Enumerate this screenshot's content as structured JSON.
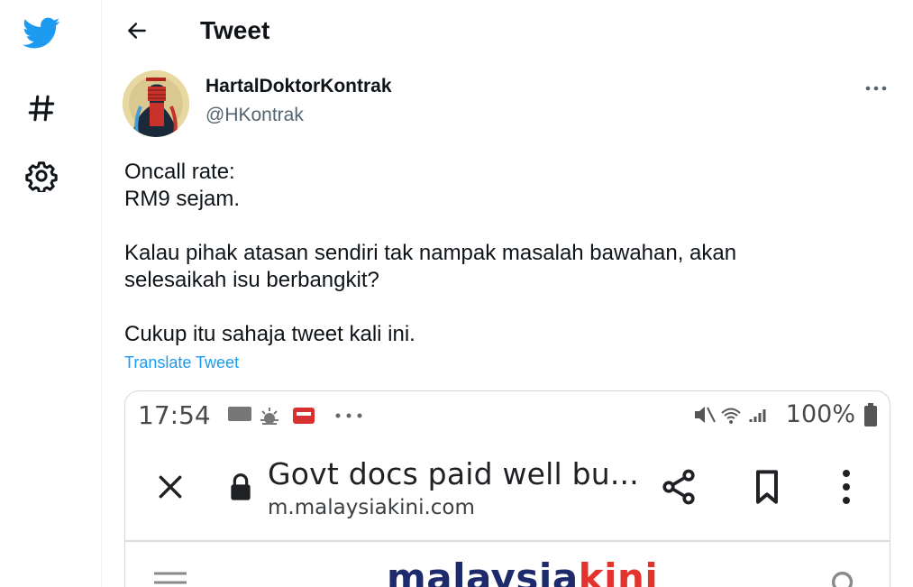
{
  "sidebar": {
    "items": [
      {
        "icon": "twitter-bird-icon"
      },
      {
        "icon": "hashtag-icon"
      },
      {
        "icon": "gear-icon"
      }
    ]
  },
  "header": {
    "title": "Tweet"
  },
  "tweet": {
    "author": {
      "display_name": "HartalDoktorKontrak",
      "handle": "@HKontrak"
    },
    "text_lines": {
      "line1": "Oncall rate:",
      "line2": "RM9 sejam.",
      "line3": "Kalau pihak atasan sendiri tak nampak masalah bawahan, akan",
      "line4": "selesaikah isu berbangkit?",
      "line5": "Cukup itu sahaja tweet kali ini."
    },
    "translate_label": "Translate Tweet"
  },
  "media": {
    "status_time": "17:54",
    "status_battery": "100%",
    "page_title": "Govt docs paid well bu...",
    "page_url": "m.malaysiakini.com",
    "site_name_main": "malaysia",
    "site_name_accent": "kini"
  },
  "colors": {
    "accent": "#1d9bf0",
    "text": "#0f1419",
    "muted": "#536471",
    "border": "#cfd9de"
  }
}
